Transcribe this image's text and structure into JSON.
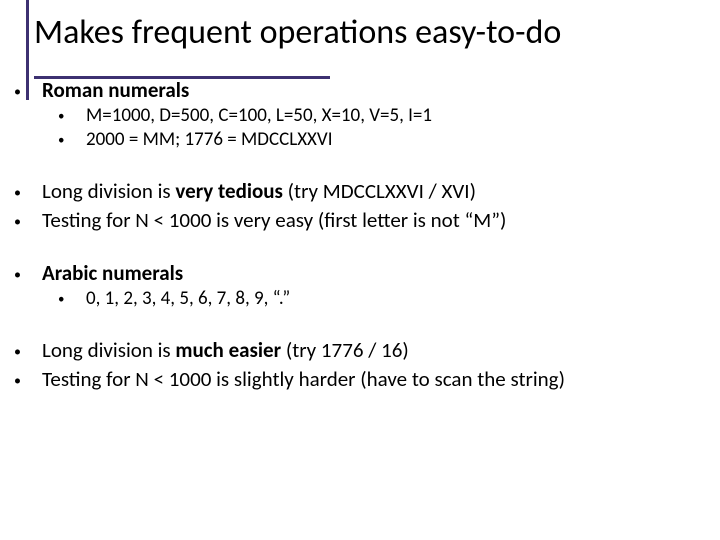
{
  "title": "Makes frequent operations easy-to-do",
  "b1": "Roman numerals",
  "b1a": "M=1000, D=500, C=100, L=50, X=10, V=5, I=1",
  "b1b": "2000 = MM;  1776 = MDCCLXXVI",
  "b2_pre": "Long division is ",
  "b2_bold": "very tedious",
  "b2_post": " (try MDCCLXXVI / XVI)",
  "b3": "Testing for N < 1000 is very easy (first letter is not “M”)",
  "b4": "Arabic numerals",
  "b4a": "0, 1, 2, 3, 4, 5, 6, 7, 8, 9, “.”",
  "b5_pre": "Long division is ",
  "b5_bold": "much easier",
  "b5_post": " (try 1776 / 16)",
  "b6": "Testing for N < 1000 is slightly harder (have to scan the string)"
}
